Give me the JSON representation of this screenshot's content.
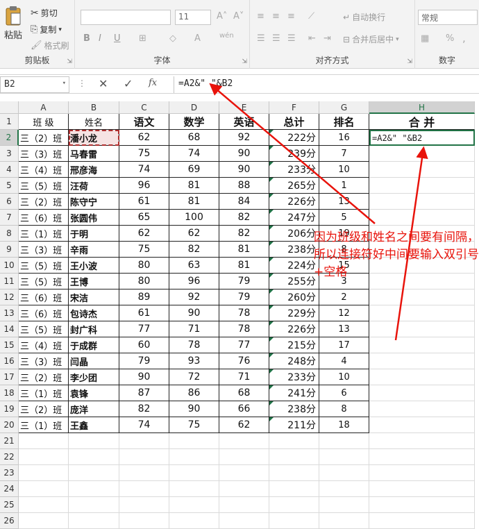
{
  "ribbon": {
    "clipboard": {
      "paste": "粘贴",
      "cut": "剪切",
      "copy": "复制",
      "format_painter": "格式刷",
      "label": "剪贴板"
    },
    "font": {
      "font_size": "11",
      "label": "字体"
    },
    "alignment": {
      "wrap_text": "自动换行",
      "merge_center": "合并后居中",
      "label": "对齐方式"
    },
    "number": {
      "format": "常规",
      "label": "数字",
      "percent": "%",
      "comma": ","
    }
  },
  "formula_bar": {
    "name_box": "B2",
    "formula": "=A2&\" \"&B2",
    "fx": "fx"
  },
  "columns": [
    "A",
    "B",
    "C",
    "D",
    "E",
    "F",
    "G",
    "H"
  ],
  "header": {
    "class": "班 级",
    "name": "姓名",
    "chinese": "语文",
    "math": "数学",
    "english": "英语",
    "total": "总计",
    "rank": "排名",
    "merge": "合 并"
  },
  "rows": [
    {
      "cls": "三（2）班",
      "name": "潘小龙",
      "c": "62",
      "m": "68",
      "e": "92",
      "t": "222分",
      "r": "16"
    },
    {
      "cls": "三（3）班",
      "name": "马春雷",
      "c": "75",
      "m": "74",
      "e": "90",
      "t": "239分",
      "r": "7"
    },
    {
      "cls": "三（4）班",
      "name": "邢彦海",
      "c": "74",
      "m": "69",
      "e": "90",
      "t": "233分",
      "r": "10"
    },
    {
      "cls": "三（5）班",
      "name": "汪荷",
      "c": "96",
      "m": "81",
      "e": "88",
      "t": "265分",
      "r": "1"
    },
    {
      "cls": "三（2）班",
      "name": "陈守宁",
      "c": "61",
      "m": "81",
      "e": "84",
      "t": "226分",
      "r": "13"
    },
    {
      "cls": "三（6）班",
      "name": "张圆伟",
      "c": "65",
      "m": "100",
      "e": "82",
      "t": "247分",
      "r": "5"
    },
    {
      "cls": "三（1）班",
      "name": "于明",
      "c": "62",
      "m": "62",
      "e": "82",
      "t": "206分",
      "r": "19"
    },
    {
      "cls": "三（3）班",
      "name": "辛雨",
      "c": "75",
      "m": "82",
      "e": "81",
      "t": "238分",
      "r": "8"
    },
    {
      "cls": "三（5）班",
      "name": "王小波",
      "c": "80",
      "m": "63",
      "e": "81",
      "t": "224分",
      "r": "15"
    },
    {
      "cls": "三（5）班",
      "name": "王博",
      "c": "80",
      "m": "96",
      "e": "79",
      "t": "255分",
      "r": "3"
    },
    {
      "cls": "三（6）班",
      "name": "宋洁",
      "c": "89",
      "m": "92",
      "e": "79",
      "t": "260分",
      "r": "2"
    },
    {
      "cls": "三（6）班",
      "name": "包诗杰",
      "c": "61",
      "m": "90",
      "e": "78",
      "t": "229分",
      "r": "12"
    },
    {
      "cls": "三（5）班",
      "name": "封广科",
      "c": "77",
      "m": "71",
      "e": "78",
      "t": "226分",
      "r": "13"
    },
    {
      "cls": "三（4）班",
      "name": "于成群",
      "c": "60",
      "m": "78",
      "e": "77",
      "t": "215分",
      "r": "17"
    },
    {
      "cls": "三（3）班",
      "name": "闫晶",
      "c": "79",
      "m": "93",
      "e": "76",
      "t": "248分",
      "r": "4"
    },
    {
      "cls": "三（2）班",
      "name": "李少团",
      "c": "90",
      "m": "72",
      "e": "71",
      "t": "233分",
      "r": "10"
    },
    {
      "cls": "三（1）班",
      "name": "袁锋",
      "c": "87",
      "m": "86",
      "e": "68",
      "t": "241分",
      "r": "6"
    },
    {
      "cls": "三（2）班",
      "name": "庞洋",
      "c": "82",
      "m": "90",
      "e": "66",
      "t": "238分",
      "r": "8"
    },
    {
      "cls": "三（1）班",
      "name": "王鑫",
      "c": "74",
      "m": "75",
      "e": "62",
      "t": "211分",
      "r": "18"
    }
  ],
  "edit_cell": {
    "formula": "=A2&\" \"&B2"
  },
  "annotation": "因为班级和姓名之间要有间隔，所以连接符好中间要输入双引号+空格",
  "colors": {
    "annotation": "#e8130b",
    "accent": "#217346"
  }
}
